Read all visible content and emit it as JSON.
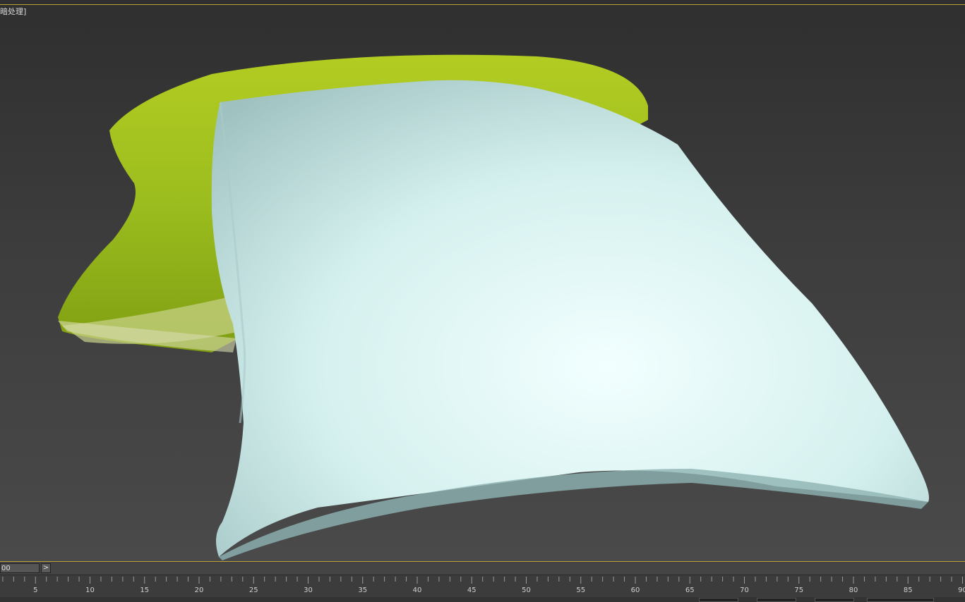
{
  "viewport": {
    "label": "暗处理",
    "label_bracket": "]"
  },
  "time_slider": {
    "frame_counter": "00",
    "next_button": ">"
  },
  "timeline": {
    "tick_labels": [
      "5",
      "10",
      "15",
      "20",
      "25",
      "30",
      "35",
      "40",
      "45",
      "50",
      "55",
      "60",
      "65",
      "70",
      "75",
      "80",
      "85",
      "90"
    ]
  },
  "colors": {
    "accent_border": "#b9a233",
    "pillow_back": "#9bbd1e",
    "pillow_front": "#d9f4f2"
  }
}
